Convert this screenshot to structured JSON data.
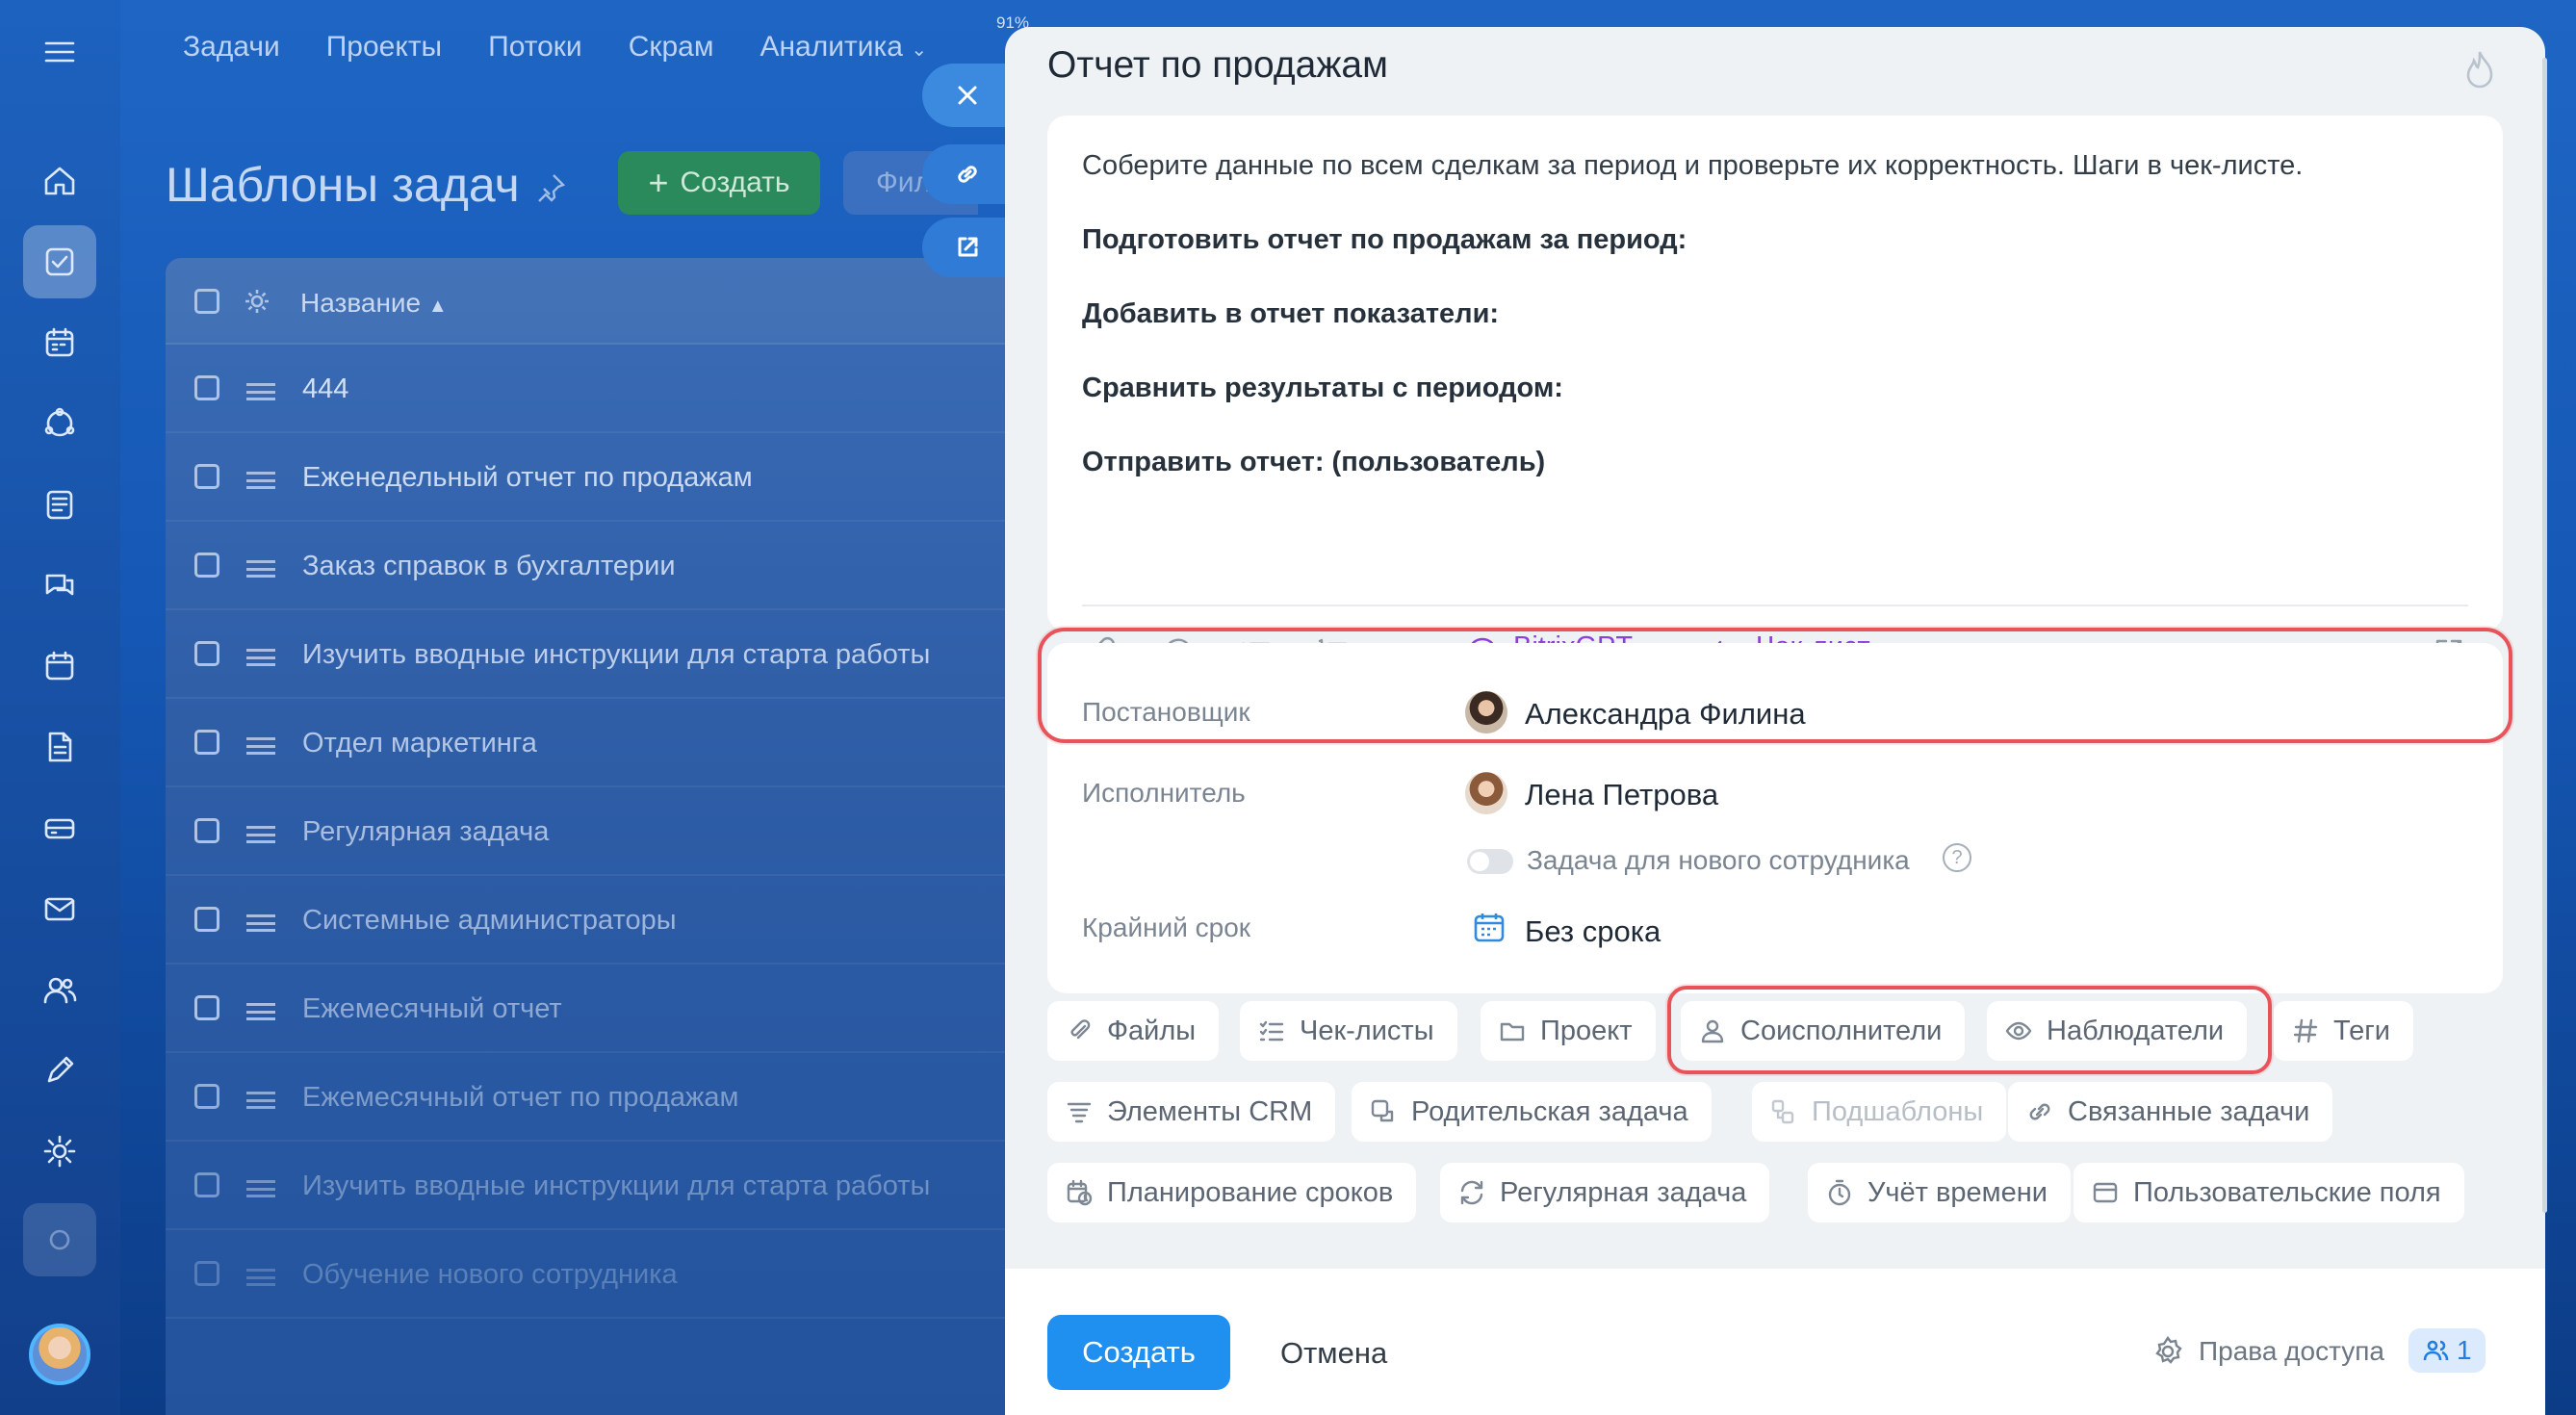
{
  "topnav": [
    "Задачи",
    "Проекты",
    "Потоки",
    "Скрам",
    "Аналитика"
  ],
  "battery": "91%",
  "page": {
    "title": "Шаблоны задач",
    "create_label": "Создать",
    "filter_label": "Фил"
  },
  "list": {
    "header": "Название",
    "rows": [
      "444",
      "Еженедельный отчет по продажам",
      "Заказ справок в бухгалтерии",
      "Изучить вводные инструкции для старта работы",
      "Отдел маркетинга",
      "Регулярная задача",
      "Системные администраторы",
      "Ежемесячный отчет",
      "Ежемесячный отчет по продажам",
      "Изучить вводные инструкции для старта работы",
      "Обучение нового сотрудника"
    ]
  },
  "modal": {
    "title": "Отчет по продажам",
    "description": {
      "intro": "Соберите данные по всем сделкам за период и проверьте их корректность. Шаги в чек-листе.",
      "lines": [
        "Подготовить отчет по продажам за период:",
        "Добавить в отчет показатели:",
        "Сравнить результаты с периодом:",
        "Отправить отчет: (пользователь)"
      ]
    },
    "toolbar": {
      "gpt_label": "BitrixGPT",
      "checklist_label": "Чек-лист"
    },
    "fields": {
      "creator_label": "Постановщик",
      "creator_name": "Александра Филина",
      "assignee_label": "Исполнитель",
      "assignee_name": "Лена Петрова",
      "new_employee_label": "Задача для нового сотрудника",
      "deadline_label": "Крайний срок",
      "deadline_value": "Без срока"
    },
    "chips": [
      "Файлы",
      "Чек-листы",
      "Проект",
      "Соисполнители",
      "Наблюдатели",
      "Теги",
      "Элементы CRM",
      "Родительская задача",
      "Подшаблоны",
      "Связанные задачи",
      "Планирование сроков",
      "Регулярная задача",
      "Учёт времени",
      "Пользовательские поля"
    ],
    "footer": {
      "create_label": "Создать",
      "cancel_label": "Отмена",
      "rights_label": "Права доступа",
      "rights_count": "1"
    }
  },
  "colors": {
    "accent": "#1f8ff0",
    "highlight": "#e8535a",
    "gpt": "#8d40d8"
  }
}
